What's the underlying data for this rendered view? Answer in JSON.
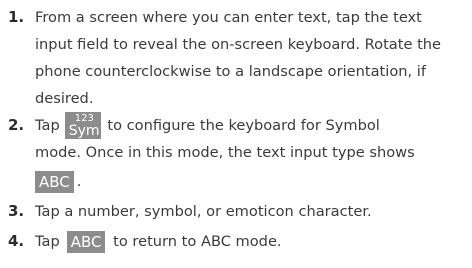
{
  "steps": [
    {
      "number": "1.",
      "lines": [
        "From a screen where you can enter text, tap the text",
        "input field to reveal the on-screen keyboard. Rotate the",
        "phone counterclockwise to a landscape orientation, if",
        "desired."
      ]
    },
    {
      "number": "2.",
      "line1_before": "Tap",
      "sym_key_top": "123",
      "sym_key_bottom": "Sym",
      "line1_after": "to configure the keyboard for Symbol",
      "line2": "mode. Once in this mode, the text input type shows",
      "line3_key": "ABC",
      "line3_after": "."
    },
    {
      "number": "3.",
      "text": "Tap a number, symbol, or emoticon character."
    },
    {
      "number": "4.",
      "before": "Tap",
      "key": "ABC",
      "after": "to return to ABC mode."
    }
  ]
}
